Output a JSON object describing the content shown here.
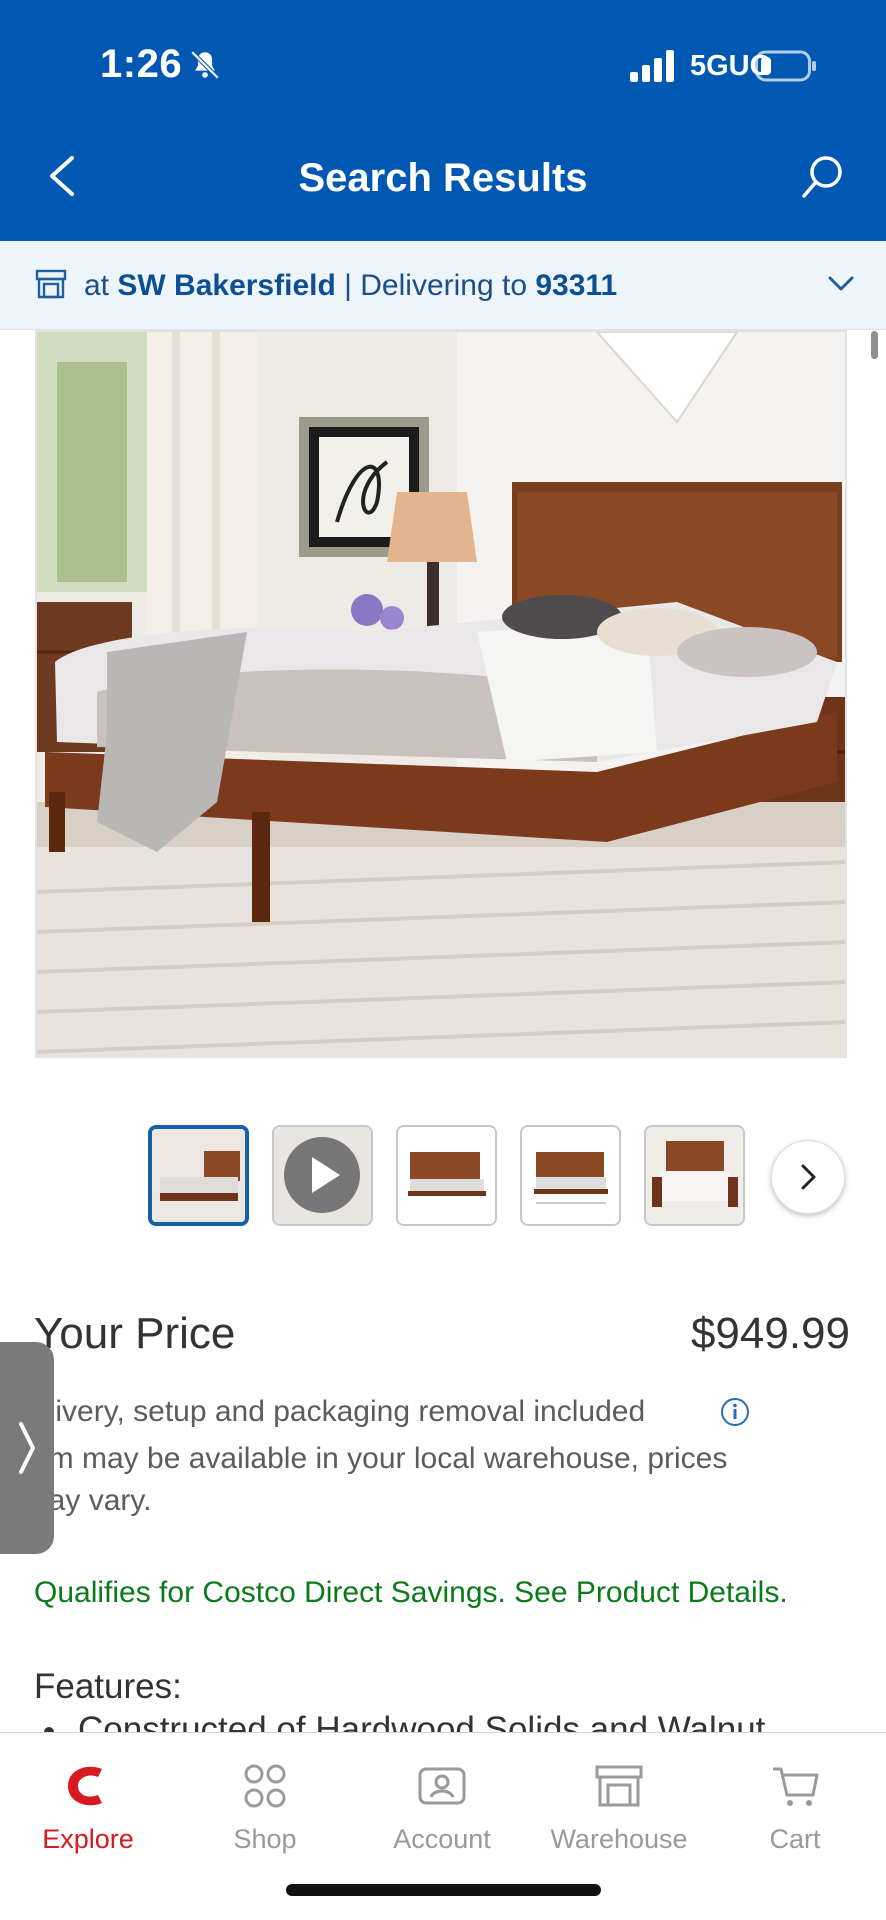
{
  "status": {
    "time": "1:26",
    "network": "5GUC",
    "icons": [
      "bell-slash-icon",
      "signal-icon",
      "battery-icon"
    ]
  },
  "header": {
    "title": "Search Results",
    "back_icon": "chevron-left-icon",
    "search_icon": "search-icon"
  },
  "location": {
    "prefix": "at",
    "store": "SW Bakersfield",
    "separator": "| Delivering to",
    "zip": "93311"
  },
  "gallery": {
    "zoom_in": "+",
    "zoom_out": "−",
    "thumbnails": [
      "bed-photo-1",
      "video",
      "bed-photo-3",
      "bed-photo-4",
      "bed-photo-5"
    ],
    "selected_index": 0
  },
  "price": {
    "label": "Your Price",
    "value": "$949.99"
  },
  "description": {
    "line1": "elivery, setup and packaging removal included",
    "line2": "em may be available in your local warehouse, prices",
    "line3": "nay vary."
  },
  "savings": "Qualifies for Costco Direct Savings. See Product Details.",
  "features": {
    "title": "Features:",
    "items": [
      "Constructed of Hardwood Solids and Walnut"
    ]
  },
  "tabs": [
    {
      "label": "Explore",
      "icon": "costco-c-icon",
      "active": true
    },
    {
      "label": "Shop",
      "icon": "grid-circles-icon",
      "active": false
    },
    {
      "label": "Account",
      "icon": "account-card-icon",
      "active": false
    },
    {
      "label": "Warehouse",
      "icon": "warehouse-icon",
      "active": false
    },
    {
      "label": "Cart",
      "icon": "cart-icon",
      "active": false
    }
  ],
  "colors": {
    "header_bg": "#0058b3",
    "accent_red": "#d71920",
    "savings_green": "#0b7a1b",
    "link_blue": "#1560a8"
  }
}
